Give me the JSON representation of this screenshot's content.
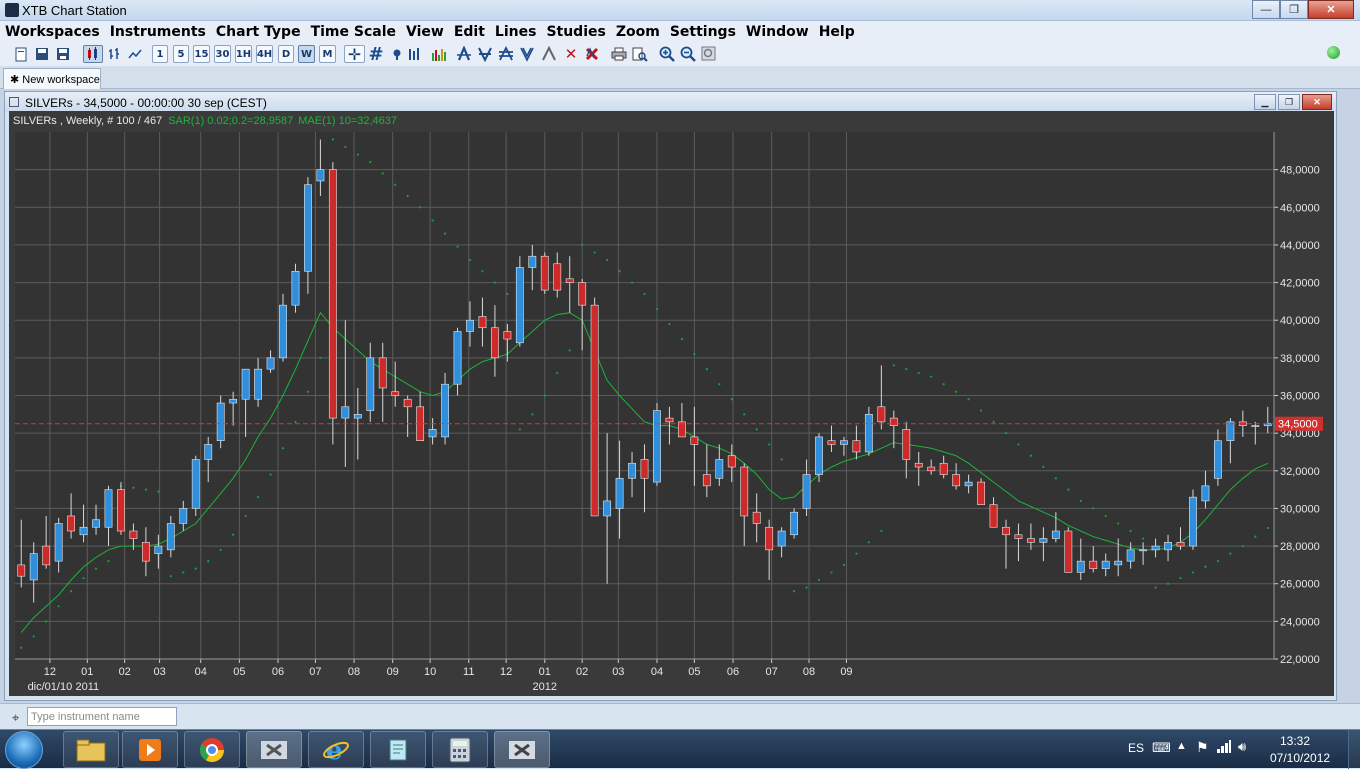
{
  "window": {
    "title": "XTB Chart Station",
    "minimize": "—",
    "maximize": "❐",
    "close": "✕"
  },
  "menu": [
    "Workspaces",
    "Instruments",
    "Chart Type",
    "Time Scale",
    "View",
    "Edit",
    "Lines",
    "Studies",
    "Zoom",
    "Settings",
    "Window",
    "Help"
  ],
  "toolbar": {
    "timeframes": [
      "1",
      "5",
      "15",
      "30",
      "1H",
      "4H",
      "D",
      "W",
      "M"
    ],
    "selected_timeframe": "W"
  },
  "tabs": [
    {
      "label": "New workspace",
      "icon": "pin-icon"
    }
  ],
  "chart_window": {
    "title": "SILVERs - 34,5000 - 00:00:00  30 sep (CEST)",
    "legend_main": "SILVERs , Weekly, # 100 / 467",
    "legend_sar": "SAR(1) 0.02;0.2=28,9587",
    "legend_mae": "MAE(1) 10=32,4637"
  },
  "colors": {
    "chart_bg": "#333333",
    "grid": "#5c5c5c",
    "bull": "#2f8fdc",
    "bear": "#cf2a2a",
    "sar": "#1f9e3a",
    "mae": "#1db33a",
    "price_line": "#d63a3a",
    "price_label_bg": "#d32f2f"
  },
  "chart_data": {
    "type": "candlestick",
    "instrument": "SILVERs",
    "timeframe": "Weekly",
    "current_price": 34.5,
    "current_price_label": "34,5000",
    "ylim": [
      22,
      50
    ],
    "y_ticks": [
      22,
      24,
      26,
      28,
      30,
      32,
      34,
      36,
      38,
      40,
      42,
      44,
      46,
      48
    ],
    "y_tick_labels": [
      "22,0000",
      "24,0000",
      "26,0000",
      "28,0000",
      "30,0000",
      "32,0000",
      "34,0000",
      "36,0000",
      "38,0000",
      "40,0000",
      "42,0000",
      "44,0000",
      "46,0000",
      "48,0000"
    ],
    "x_labels": [
      {
        "i": 2.3,
        "label": "12",
        "sub": "dic/01/10"
      },
      {
        "i": 5.3,
        "label": "01",
        "sub": "2011"
      },
      {
        "i": 8.3,
        "label": "02",
        "sub": ""
      },
      {
        "i": 11.1,
        "label": "03",
        "sub": ""
      },
      {
        "i": 14.4,
        "label": "04",
        "sub": ""
      },
      {
        "i": 17.5,
        "label": "05",
        "sub": ""
      },
      {
        "i": 20.6,
        "label": "06",
        "sub": ""
      },
      {
        "i": 23.6,
        "label": "07",
        "sub": ""
      },
      {
        "i": 26.7,
        "label": "08",
        "sub": ""
      },
      {
        "i": 29.8,
        "label": "09",
        "sub": ""
      },
      {
        "i": 32.8,
        "label": "10",
        "sub": ""
      },
      {
        "i": 35.9,
        "label": "11",
        "sub": ""
      },
      {
        "i": 38.9,
        "label": "12",
        "sub": ""
      },
      {
        "i": 42.0,
        "label": "01",
        "sub": "2012"
      },
      {
        "i": 45.0,
        "label": "02",
        "sub": ""
      },
      {
        "i": 47.9,
        "label": "03",
        "sub": ""
      },
      {
        "i": 51.0,
        "label": "04",
        "sub": ""
      },
      {
        "i": 54.0,
        "label": "05",
        "sub": ""
      },
      {
        "i": 57.1,
        "label": "06",
        "sub": ""
      },
      {
        "i": 60.2,
        "label": "07",
        "sub": ""
      },
      {
        "i": 63.2,
        "label": "08",
        "sub": ""
      },
      {
        "i": 66.2,
        "label": "09",
        "sub": ""
      }
    ],
    "candles": [
      [
        27.0,
        29.4,
        25.8,
        26.4
      ],
      [
        26.2,
        28.2,
        25.0,
        27.6
      ],
      [
        28.0,
        29.6,
        26.8,
        27.0
      ],
      [
        27.2,
        29.5,
        26.6,
        29.2
      ],
      [
        29.6,
        30.8,
        28.4,
        28.8
      ],
      [
        28.6,
        30.2,
        28.2,
        29.0
      ],
      [
        29.0,
        30.2,
        28.6,
        29.4
      ],
      [
        29.0,
        31.2,
        28.0,
        31.0
      ],
      [
        31.0,
        31.4,
        28.6,
        28.8
      ],
      [
        28.8,
        29.2,
        27.8,
        28.4
      ],
      [
        28.2,
        29.0,
        26.4,
        27.2
      ],
      [
        27.6,
        28.6,
        26.8,
        28.0
      ],
      [
        27.8,
        29.6,
        27.4,
        29.2
      ],
      [
        29.2,
        30.4,
        28.8,
        30.0
      ],
      [
        30.0,
        32.8,
        29.6,
        32.6
      ],
      [
        32.6,
        33.8,
        31.4,
        33.4
      ],
      [
        33.6,
        36.0,
        33.2,
        35.6
      ],
      [
        35.6,
        36.2,
        34.4,
        35.8
      ],
      [
        35.8,
        37.4,
        33.8,
        37.4
      ],
      [
        35.8,
        38.0,
        35.4,
        37.4
      ],
      [
        37.4,
        38.4,
        37.2,
        38.0
      ],
      [
        38.0,
        41.4,
        37.8,
        40.8
      ],
      [
        40.8,
        43.0,
        40.4,
        42.6
      ],
      [
        42.6,
        47.6,
        41.4,
        47.2
      ],
      [
        47.4,
        49.6,
        46.6,
        48.0
      ],
      [
        48.0,
        48.4,
        33.4,
        34.8
      ],
      [
        34.8,
        40.0,
        32.2,
        35.4
      ],
      [
        34.8,
        36.4,
        32.6,
        35.0
      ],
      [
        35.2,
        38.8,
        34.6,
        38.0
      ],
      [
        38.0,
        38.8,
        34.6,
        36.4
      ],
      [
        36.2,
        37.8,
        35.4,
        36.0
      ],
      [
        35.8,
        36.0,
        33.8,
        35.4
      ],
      [
        35.4,
        36.2,
        33.6,
        33.6
      ],
      [
        33.8,
        34.8,
        33.4,
        34.2
      ],
      [
        33.8,
        37.2,
        33.4,
        36.6
      ],
      [
        36.6,
        39.6,
        36.0,
        39.4
      ],
      [
        39.4,
        41.0,
        38.6,
        40.0
      ],
      [
        40.2,
        41.2,
        38.6,
        39.6
      ],
      [
        39.6,
        40.8,
        37.0,
        38.0
      ],
      [
        39.4,
        39.8,
        37.8,
        39.0
      ],
      [
        38.8,
        43.4,
        38.6,
        42.8
      ],
      [
        42.8,
        44.0,
        41.6,
        43.4
      ],
      [
        43.4,
        43.6,
        41.4,
        41.6
      ],
      [
        43.0,
        43.6,
        41.2,
        41.6
      ],
      [
        42.2,
        43.4,
        40.4,
        42.0
      ],
      [
        42.0,
        42.2,
        38.4,
        40.8
      ],
      [
        40.8,
        41.2,
        29.8,
        29.6
      ],
      [
        29.6,
        34.0,
        26.0,
        30.4
      ],
      [
        30.0,
        33.6,
        28.4,
        31.6
      ],
      [
        31.6,
        33.0,
        30.6,
        32.4
      ],
      [
        32.6,
        33.4,
        29.8,
        31.6
      ],
      [
        31.4,
        35.6,
        31.2,
        35.2
      ],
      [
        34.8,
        35.4,
        33.4,
        34.6
      ],
      [
        34.6,
        35.6,
        33.8,
        33.8
      ],
      [
        33.8,
        35.4,
        31.2,
        33.4
      ],
      [
        31.8,
        33.4,
        30.6,
        31.2
      ],
      [
        31.6,
        33.4,
        31.2,
        32.6
      ],
      [
        32.8,
        33.4,
        31.4,
        32.2
      ],
      [
        32.2,
        32.4,
        28.0,
        29.6
      ],
      [
        29.8,
        30.8,
        28.2,
        29.2
      ],
      [
        29.0,
        29.4,
        26.2,
        27.8
      ],
      [
        28.0,
        29.0,
        27.4,
        28.8
      ],
      [
        28.6,
        30.0,
        28.4,
        29.8
      ],
      [
        30.0,
        32.6,
        29.6,
        31.8
      ],
      [
        31.8,
        34.0,
        31.4,
        33.8
      ],
      [
        33.6,
        34.4,
        33.0,
        33.4
      ],
      [
        33.4,
        33.8,
        32.8,
        33.6
      ],
      [
        33.6,
        34.4,
        32.6,
        33.0
      ],
      [
        33.0,
        35.4,
        32.8,
        35.0
      ],
      [
        35.4,
        37.6,
        34.2,
        34.6
      ],
      [
        34.8,
        35.2,
        33.2,
        34.4
      ],
      [
        34.2,
        34.6,
        31.6,
        32.6
      ],
      [
        32.4,
        33.0,
        31.2,
        32.2
      ],
      [
        32.2,
        32.6,
        31.8,
        32.0
      ],
      [
        32.4,
        32.8,
        31.6,
        31.8
      ],
      [
        31.8,
        32.4,
        31.0,
        31.2
      ],
      [
        31.2,
        31.8,
        30.8,
        31.4
      ],
      [
        31.4,
        31.6,
        30.8,
        30.2
      ],
      [
        30.2,
        30.6,
        29.0,
        29.0
      ],
      [
        29.0,
        29.4,
        26.8,
        28.6
      ],
      [
        28.6,
        29.2,
        27.2,
        28.4
      ],
      [
        28.4,
        29.2,
        27.8,
        28.2
      ],
      [
        28.2,
        29.0,
        27.2,
        28.4
      ],
      [
        28.4,
        29.8,
        28.2,
        28.8
      ],
      [
        28.8,
        29.0,
        26.6,
        26.6
      ],
      [
        26.6,
        28.4,
        26.2,
        27.2
      ],
      [
        27.2,
        28.0,
        26.6,
        26.8
      ],
      [
        26.8,
        27.6,
        26.4,
        27.2
      ],
      [
        27.0,
        28.4,
        26.4,
        27.2
      ],
      [
        27.2,
        28.2,
        26.8,
        27.8
      ],
      [
        27.8,
        28.2,
        27.0,
        27.8
      ],
      [
        27.8,
        28.4,
        27.4,
        28.0
      ],
      [
        27.8,
        28.6,
        27.2,
        28.2
      ],
      [
        28.2,
        29.0,
        27.8,
        28.0
      ],
      [
        28.0,
        31.0,
        27.8,
        30.6
      ],
      [
        30.4,
        32.0,
        30.0,
        31.2
      ],
      [
        31.6,
        34.2,
        31.2,
        33.6
      ],
      [
        33.6,
        34.8,
        32.4,
        34.6
      ],
      [
        34.6,
        35.2,
        33.8,
        34.4
      ],
      [
        34.4,
        34.6,
        33.4,
        34.4
      ],
      [
        34.4,
        35.4,
        34.0,
        34.5
      ]
    ],
    "mae": [
      23.4,
      24.2,
      24.8,
      25.4,
      26.2,
      26.9,
      27.4,
      27.8,
      28.0,
      28.0,
      28.0,
      28.1,
      28.4,
      28.8,
      29.2,
      30.0,
      30.8,
      31.6,
      32.6,
      33.8,
      34.8,
      36.0,
      37.4,
      38.9,
      40.4,
      39.6,
      39.0,
      38.4,
      37.8,
      37.4,
      37.0,
      36.6,
      36.2,
      36.0,
      36.2,
      36.8,
      37.4,
      37.8,
      38.0,
      38.2,
      38.8,
      39.4,
      40.0,
      40.3,
      40.4,
      40.0,
      38.4,
      36.8,
      36.0,
      35.3,
      34.6,
      34.4,
      34.4,
      34.2,
      33.8,
      33.4,
      33.2,
      32.9,
      32.4,
      31.8,
      31.0,
      30.5,
      30.6,
      31.2,
      31.8,
      32.2,
      32.5,
      32.7,
      32.9,
      33.2,
      33.5,
      33.4,
      33.3,
      33.2,
      33.0,
      32.8,
      32.4,
      31.9,
      31.4,
      30.9,
      30.4,
      30.1,
      29.8,
      29.5,
      29.1,
      28.8,
      28.5,
      28.3,
      28.1,
      27.9,
      27.8,
      27.8,
      27.9,
      28.2,
      28.7,
      29.4,
      30.2,
      31.0,
      31.6,
      32.1,
      32.4
    ],
    "sar": [
      22.6,
      23.2,
      24.0,
      24.8,
      25.6,
      26.3,
      26.8,
      27.2,
      31.2,
      31.1,
      31.0,
      30.9,
      26.4,
      26.6,
      26.8,
      27.2,
      27.8,
      28.6,
      29.6,
      30.6,
      31.8,
      33.2,
      34.6,
      36.2,
      38.0,
      49.6,
      49.2,
      48.8,
      48.4,
      47.8,
      47.2,
      46.6,
      46.0,
      45.3,
      44.6,
      43.9,
      43.2,
      42.6,
      42.0,
      41.4,
      34.2,
      35.0,
      36.0,
      37.2,
      38.4,
      44.0,
      43.6,
      43.2,
      42.6,
      42.0,
      41.4,
      40.6,
      39.8,
      39.0,
      38.2,
      37.4,
      36.6,
      35.8,
      35.0,
      34.2,
      33.4,
      32.6,
      25.6,
      25.8,
      26.2,
      26.6,
      27.0,
      27.6,
      28.2,
      28.8,
      37.6,
      37.4,
      37.2,
      37.0,
      36.6,
      36.2,
      35.8,
      35.2,
      34.6,
      34.0,
      33.4,
      32.8,
      32.2,
      31.6,
      31.0,
      30.4,
      30.0,
      29.6,
      29.2,
      28.8,
      28.4,
      25.8,
      26.0,
      26.3,
      26.6,
      26.9,
      27.2,
      27.6,
      28.0,
      28.5,
      28.96
    ]
  },
  "bottom": {
    "search_placeholder": "Type instrument name"
  },
  "taskbar": {
    "language": "ES",
    "time": "13:32",
    "date": "07/10/2012"
  }
}
